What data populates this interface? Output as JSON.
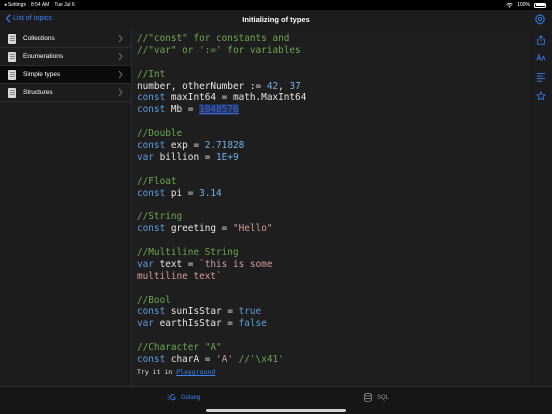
{
  "status_bar": {
    "back_app": "◂ Settings",
    "time": "8:54 AM",
    "date": "Tue Jul 6",
    "battery": "100%"
  },
  "nav": {
    "back_label": "List of topics",
    "title": "Initializing of types"
  },
  "sidebar": {
    "items": [
      {
        "label": "Collections",
        "active": false
      },
      {
        "label": "Enumerations",
        "active": false
      },
      {
        "label": "Simple types",
        "active": true
      },
      {
        "label": "Structures",
        "active": false
      }
    ]
  },
  "code": {
    "lines": [
      [
        {
          "t": "//\"const\" for constants and",
          "k": "comment"
        }
      ],
      [
        {
          "t": "//\"var\" or ':=' for variables",
          "k": "comment"
        }
      ],
      [],
      [
        {
          "t": "//Int",
          "k": "comment"
        }
      ],
      [
        {
          "t": "number, otherNumber := ",
          "k": "txt"
        },
        {
          "t": "42",
          "k": "num"
        },
        {
          "t": ", ",
          "k": "txt"
        },
        {
          "t": "37",
          "k": "num"
        }
      ],
      [
        {
          "t": "const",
          "k": "kw"
        },
        {
          "t": " maxInt64 = math.MaxInt64",
          "k": "txt"
        }
      ],
      [
        {
          "t": "const",
          "k": "kw"
        },
        {
          "t": " Mb = ",
          "k": "txt"
        },
        {
          "t": "1048576",
          "k": "link"
        }
      ],
      [],
      [
        {
          "t": "//Double",
          "k": "comment"
        }
      ],
      [
        {
          "t": "const",
          "k": "kw"
        },
        {
          "t": " exp = ",
          "k": "txt"
        },
        {
          "t": "2.71828",
          "k": "num"
        }
      ],
      [
        {
          "t": "var",
          "k": "kw"
        },
        {
          "t": " billion = ",
          "k": "txt"
        },
        {
          "t": "1E+9",
          "k": "num"
        }
      ],
      [],
      [
        {
          "t": "//Float",
          "k": "comment"
        }
      ],
      [
        {
          "t": "const",
          "k": "kw"
        },
        {
          "t": " pi = ",
          "k": "txt"
        },
        {
          "t": "3.14",
          "k": "num"
        }
      ],
      [],
      [
        {
          "t": "//String",
          "k": "comment"
        }
      ],
      [
        {
          "t": "const",
          "k": "kw"
        },
        {
          "t": " greeting = ",
          "k": "txt"
        },
        {
          "t": "\"Hello\"",
          "k": "str"
        }
      ],
      [],
      [
        {
          "t": "//Multiline String",
          "k": "comment"
        }
      ],
      [
        {
          "t": "var",
          "k": "kw"
        },
        {
          "t": " text = ",
          "k": "txt"
        },
        {
          "t": "`this is some",
          "k": "str"
        }
      ],
      [
        {
          "t": "multiline text`",
          "k": "str"
        }
      ],
      [],
      [
        {
          "t": "//Bool",
          "k": "comment"
        }
      ],
      [
        {
          "t": "const",
          "k": "kw"
        },
        {
          "t": " sunIsStar = ",
          "k": "txt"
        },
        {
          "t": "true",
          "k": "kw"
        }
      ],
      [
        {
          "t": "var",
          "k": "kw"
        },
        {
          "t": " earthIsStar = ",
          "k": "txt"
        },
        {
          "t": "false",
          "k": "kw"
        }
      ],
      [],
      [
        {
          "t": "//Character \"A\"",
          "k": "comment"
        }
      ],
      [
        {
          "t": "const",
          "k": "kw"
        },
        {
          "t": " charA = ",
          "k": "txt"
        },
        {
          "t": "'A'",
          "k": "str"
        },
        {
          "t": " //'\\x41'",
          "k": "comment"
        }
      ]
    ],
    "try_it_prefix": "Try it in ",
    "try_it_link": "Playground"
  },
  "tabs": [
    {
      "label": "Golang",
      "icon": "golang-icon",
      "selected": true
    },
    {
      "label": "SQL",
      "icon": "database-icon",
      "selected": false
    }
  ],
  "colors": {
    "accent": "#3b82f6",
    "comment": "#6aa84f",
    "keyword": "#5c9ee0",
    "string": "#d49a9a"
  }
}
